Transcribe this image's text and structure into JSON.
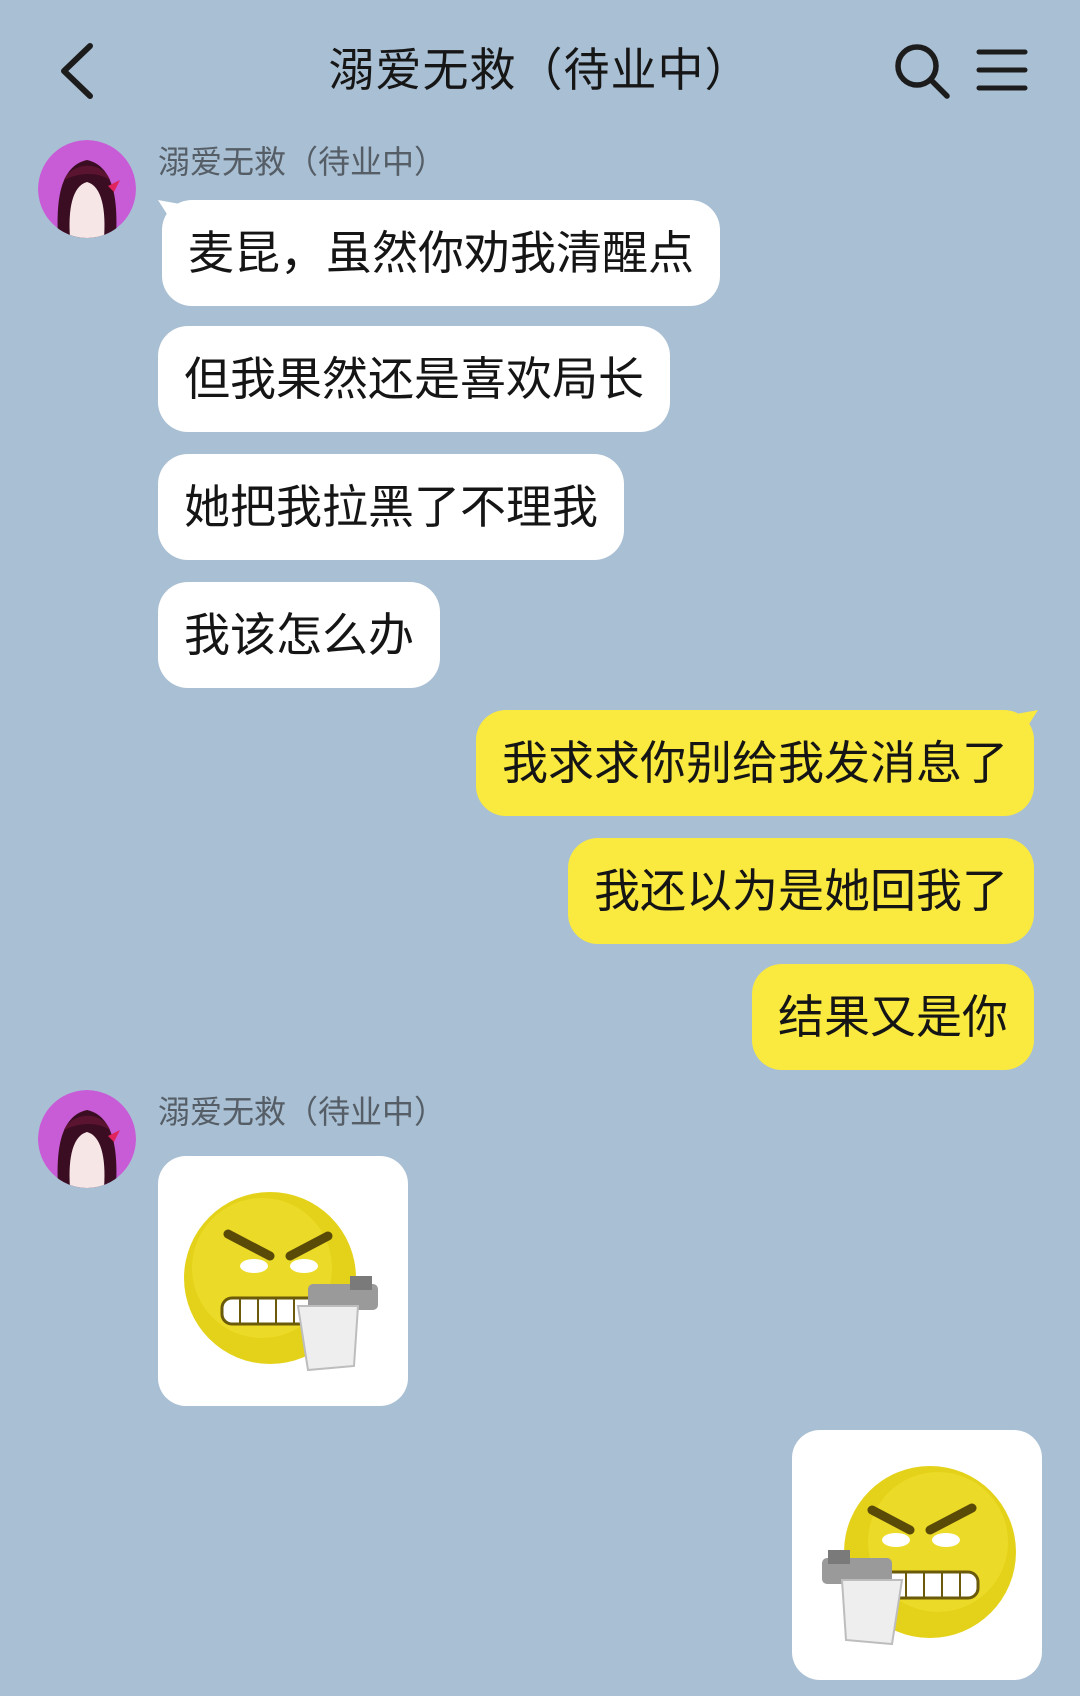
{
  "header": {
    "title": "溺爱无救（待业中）",
    "back_icon": "chevron-left-icon",
    "search_icon": "search-icon",
    "menu_icon": "menu-icon"
  },
  "colors": {
    "background": "#a9bfd3",
    "incoming_bubble": "#ffffff",
    "outgoing_bubble": "#fae93f",
    "sender_name": "#555d66"
  },
  "groups": [
    {
      "sender": "溺爱无救（待业中）",
      "direction": "incoming",
      "messages": [
        "麦昆，虽然你劝我清醒点",
        "但我果然还是喜欢局长",
        "她把我拉黑了不理我",
        "我该怎么办"
      ]
    },
    {
      "direction": "outgoing",
      "messages": [
        "我求求你别给我发消息了",
        "我还以为是她回我了",
        "结果又是你"
      ]
    },
    {
      "sender": "溺爱无救（待业中）",
      "direction": "incoming",
      "sticker": "angry-emoji-gun-sticker"
    },
    {
      "direction": "outgoing",
      "sticker": "angry-emoji-gun-sticker"
    }
  ]
}
